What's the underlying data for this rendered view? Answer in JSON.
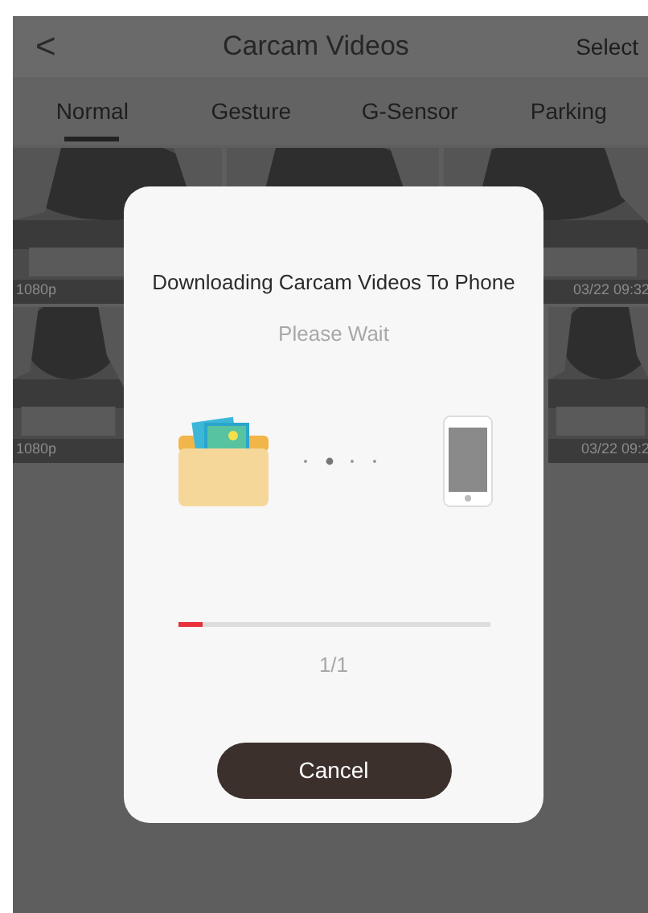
{
  "header": {
    "back": "<",
    "title": "Carcam Videos",
    "action": "Select"
  },
  "tabs": [
    {
      "label": "Normal",
      "selected": true
    },
    {
      "label": "Gesture",
      "selected": false
    },
    {
      "label": "G-Sensor",
      "selected": false
    },
    {
      "label": "Parking",
      "selected": false
    }
  ],
  "thumbnail_rows": [
    [
      {
        "kind": "picture",
        "resolution": "1080p"
      },
      {
        "kind": "picture"
      },
      {
        "kind": "picture",
        "timestamp": "03/22 09:32"
      }
    ],
    [
      {
        "kind": "picture",
        "resolution": "1080p"
      },
      {
        "kind": "picture",
        "timestamp": "03/22 09:2"
      }
    ]
  ],
  "dialog": {
    "title": "Downloading Carcam Videos To Phone",
    "subtitle": "Please Wait",
    "progress": {
      "level": 0.08
    },
    "count": "1/1",
    "button": "Cancel"
  }
}
